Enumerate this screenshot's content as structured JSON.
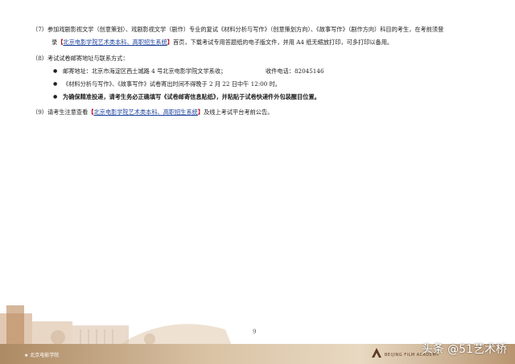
{
  "item7": {
    "line1": "（7）参加戏剧影视文学（创意策划）、戏剧影视文学（剧作）专业的复试《材料分析与写作》（创意策划方向）、《故事写作》（剧作方向）科目的考生，在考前须登",
    "prefix": "录",
    "bracket_open": "【",
    "link_text": "北京电影学院艺术类本科、高职招生系统",
    "bracket_close": "】",
    "suffix": "首页，下载考试专用答题纸的电子版文件，并用 A4 纸无缩放打印，可多打印以备用。"
  },
  "item8": {
    "title": "（8）考试试卷邮寄地址与联系方式：",
    "b1_address": "邮寄地址：北京市海淀区西土城路 4 号北京电影学院文学系收；",
    "b1_phone": "收件电话：82045146",
    "b2": "《材料分析与写作》、《故事写作》试卷寄出时间不得晚于 2 月 22 日中午 12:00 时。",
    "b3": "为确保精准投递，请考生务必正确填写《试卷邮寄信息贴纸》，并粘贴于试卷快递件外包装醒目位置。"
  },
  "item9": {
    "prefix": "（9）请考生注意查看",
    "bracket_open": "【",
    "link_text": "北京电影学院艺术类本科、高职招生系统",
    "bracket_close": "】",
    "suffix": "及线上考试平台考前公告。"
  },
  "page_number": "9",
  "footer": {
    "logo_left": "北京电影学院",
    "logo_right": "BEIJING FILM ACADEMY",
    "watermark": "头条 @51艺术桥"
  },
  "colors": {
    "link": "#1a3f9c",
    "bracket": "#b0141c",
    "band": "#c9a982"
  }
}
